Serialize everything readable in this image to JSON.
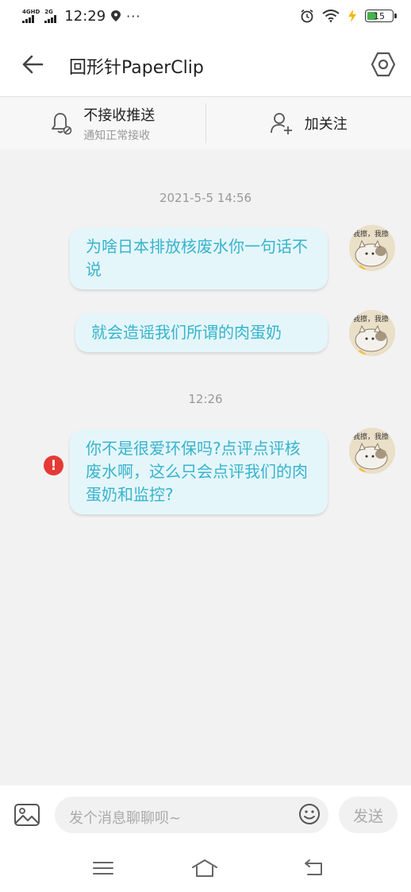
{
  "status_bar": {
    "network_1": "4GHD",
    "network_2": "2G",
    "time": "12:29",
    "more": "···",
    "battery": "15"
  },
  "header": {
    "title": "回形针PaperClip",
    "back_icon": "arrow-left-icon",
    "settings_icon": "hexagon-settings-icon"
  },
  "subscription": {
    "mute_label": "不接收推送",
    "mute_hint": "通知正常接收",
    "follow_label": "加关注"
  },
  "messages": {
    "time_1": "2021-5-5 14:56",
    "msg_1": "为啥日本排放核废水你一句话不说",
    "msg_2": "就会造谣我们所谓的肉蛋奶",
    "time_2": "12:26",
    "msg_3": "你不是很爱环保吗?点评点评核废水啊，这么只会点评我们的肉蛋奶和监控?",
    "error_mark": "!",
    "avatar_text": "我擦，我擦"
  },
  "composer": {
    "placeholder": "发个消息聊聊呗~",
    "send_label": "发送"
  },
  "colors": {
    "bubble_bg": "#e5f6fb",
    "bubble_text": "#36b4cc",
    "error": "#e53935"
  }
}
